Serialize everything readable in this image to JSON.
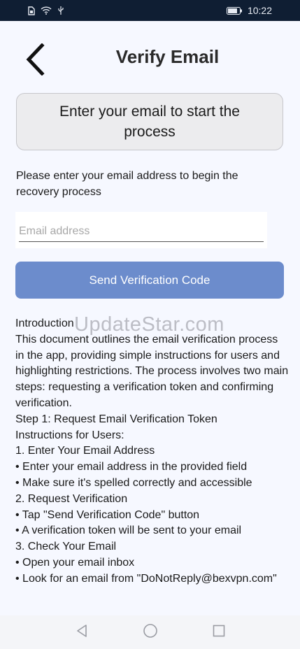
{
  "status_bar": {
    "time": "10:22",
    "icons": [
      "sim-icon",
      "wifi-icon",
      "usb-icon",
      "battery-icon"
    ]
  },
  "header": {
    "title": "Verify Email",
    "back_icon": "chevron-left-icon"
  },
  "banner": {
    "text": "Enter your email to start the process"
  },
  "instruction": "Please enter your email address to begin the recovery process",
  "email_field": {
    "placeholder": "Email address",
    "value": ""
  },
  "send_button": {
    "label": "Send Verification Code",
    "color": "#6c8ccc"
  },
  "watermark": "UpdateStar.com",
  "document": {
    "lines": [
      "Introduction",
      "This document outlines the email verification process in the app, providing simple instructions for users and highlighting restrictions. The process involves two main steps: requesting a verification token and confirming verification.",
      "Step 1: Request Email Verification Token",
      "Instructions for Users:",
      "1. Enter Your Email Address",
      "• Enter your email address in the provided field",
      "• Make sure it's spelled correctly and accessible",
      "2. Request Verification",
      "• Tap \"Send Verification Code\" button",
      "• A verification token will be sent to your email",
      "3. Check Your Email",
      "• Open your email inbox",
      "• Look for an email from \"DoNotReply@bexvpn.com\""
    ]
  },
  "nav_bar": {
    "buttons": [
      "back-triangle-icon",
      "home-circle-icon",
      "recents-square-icon"
    ]
  }
}
